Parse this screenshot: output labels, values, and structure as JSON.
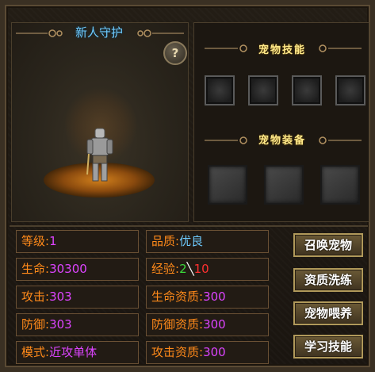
{
  "preview": {
    "pet_name": "新人守护",
    "help_label": "?"
  },
  "right_panel": {
    "skills_title": "宠物技能",
    "equipment_title": "宠物装备"
  },
  "stats": {
    "level_label": "等级:",
    "level_value": "1",
    "quality_label": "品质:",
    "quality_value": "优良",
    "hp_label": "生命:",
    "hp_value": "30300",
    "exp_label": "经验:",
    "exp_current": "2",
    "exp_sep": "╲",
    "exp_max": "10",
    "attack_label": "攻击:",
    "attack_value": "303",
    "hp_aptitude_label": "生命资质:",
    "hp_aptitude_value": "300",
    "defense_label": "防御:",
    "defense_value": "303",
    "defense_aptitude_label": "防御资质:",
    "defense_aptitude_value": "300",
    "mode_label": "模式:",
    "mode_value": "近攻单体",
    "attack_aptitude_label": "攻击资质:",
    "attack_aptitude_value": "300"
  },
  "actions": {
    "summon": "召唤宠物",
    "reset_aptitude": "资质洗练",
    "feed": "宠物喂养",
    "learn_skill": "学习技能"
  },
  "colors": {
    "label": "#ff8a1a",
    "value": "#dd44ff",
    "quality": "#6ecbff",
    "title": "#ffe98a"
  }
}
